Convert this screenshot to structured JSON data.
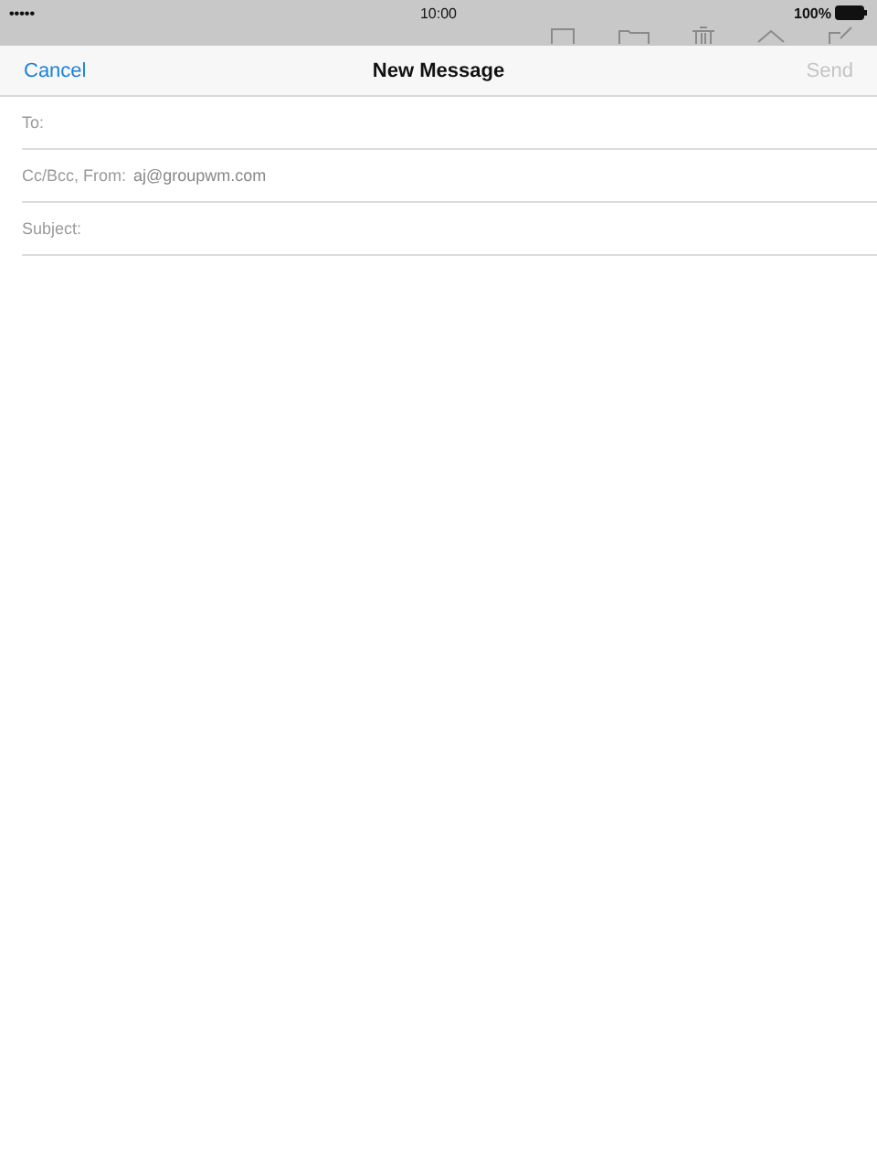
{
  "status_bar": {
    "signal": "•••••",
    "time": "10:00",
    "battery": "100%"
  },
  "nav": {
    "cancel": "Cancel",
    "title": "New Message",
    "send": "Send",
    "send_disabled": true
  },
  "fields": [
    {
      "label": "To:"
    },
    {
      "label": "Cc/Bcc, From:",
      "value": "aj@groupwm.com"
    },
    {
      "label": "Subject:"
    }
  ]
}
